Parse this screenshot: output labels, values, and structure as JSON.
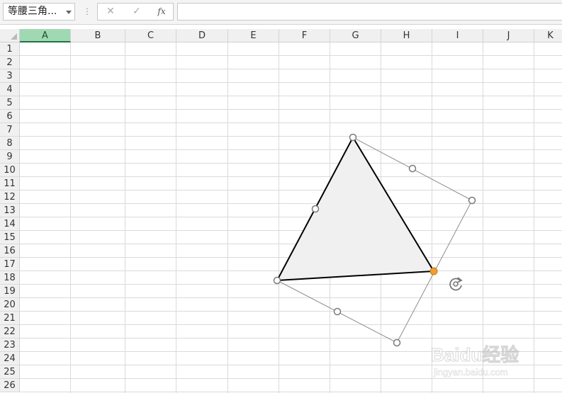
{
  "formula_bar": {
    "name_box_value": "等腰三角...",
    "cancel_symbol": "✕",
    "enter_symbol": "✓",
    "fx_label": "fx",
    "formula_value": ""
  },
  "columns": [
    {
      "label": "A",
      "selected": true
    },
    {
      "label": "B",
      "selected": false
    },
    {
      "label": "C",
      "selected": false
    },
    {
      "label": "D",
      "selected": false
    },
    {
      "label": "E",
      "selected": false
    },
    {
      "label": "F",
      "selected": false
    },
    {
      "label": "G",
      "selected": false
    },
    {
      "label": "H",
      "selected": false
    },
    {
      "label": "I",
      "selected": false
    },
    {
      "label": "J",
      "selected": false
    },
    {
      "label": "K",
      "selected": false
    }
  ],
  "rows": [
    "1",
    "2",
    "3",
    "4",
    "5",
    "6",
    "7",
    "8",
    "9",
    "10",
    "11",
    "12",
    "13",
    "14",
    "15",
    "16",
    "17",
    "18",
    "19",
    "20",
    "21",
    "22",
    "23",
    "24",
    "25",
    "26"
  ],
  "shape": {
    "name": "等腰三角形",
    "fill": "#f0f0f0",
    "stroke": "#000000",
    "handle_accent": "#f0a030",
    "rotate_icon": "rotate-icon"
  },
  "watermark": {
    "brand": "Baidu经验",
    "url": "jingyan.baidu.com"
  }
}
